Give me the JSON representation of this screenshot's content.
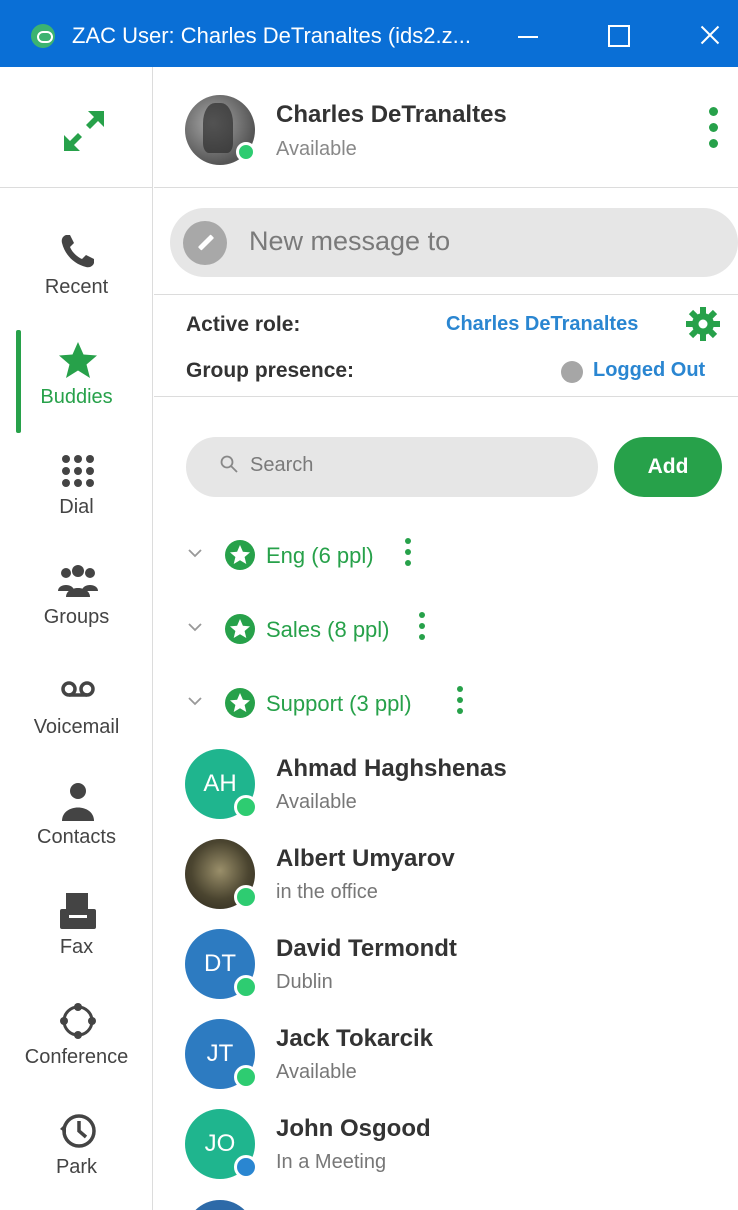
{
  "window": {
    "title": "ZAC User: Charles DeTranaltes (ids2.z..."
  },
  "nav": {
    "items": [
      {
        "label": "Recent",
        "icon": "phone-icon"
      },
      {
        "label": "Buddies",
        "icon": "star-icon",
        "active": true
      },
      {
        "label": "Dial",
        "icon": "dialpad-icon"
      },
      {
        "label": "Groups",
        "icon": "group-icon"
      },
      {
        "label": "Voicemail",
        "icon": "voicemail-icon"
      },
      {
        "label": "Contacts",
        "icon": "person-icon"
      },
      {
        "label": "Fax",
        "icon": "fax-icon"
      },
      {
        "label": "Conference",
        "icon": "conference-icon"
      },
      {
        "label": "Park",
        "icon": "clock-icon"
      }
    ]
  },
  "user": {
    "name": "Charles DeTranaltes",
    "status": "Available"
  },
  "compose": {
    "placeholder": "New message to"
  },
  "role": {
    "active_role_label": "Active role:",
    "active_role_value": "Charles DeTranaltes",
    "group_presence_label": "Group presence:",
    "group_presence_value": "Logged Out"
  },
  "search": {
    "placeholder": "Search"
  },
  "add_button": "Add",
  "groups": [
    {
      "label": "Eng (6 ppl)"
    },
    {
      "label": "Sales (8 ppl)"
    },
    {
      "label": "Support (3 ppl)"
    }
  ],
  "buddies": [
    {
      "initials": "AH",
      "name": "Ahmad Haghshenas",
      "status": "Available",
      "presence": "available"
    },
    {
      "initials": "",
      "name": "Albert Umyarov",
      "status": "in the office",
      "presence": "available"
    },
    {
      "initials": "DT",
      "name": "David Termondt",
      "status": "Dublin",
      "presence": "available"
    },
    {
      "initials": "JT",
      "name": "Jack Tokarcik",
      "status": "Available",
      "presence": "available"
    },
    {
      "initials": "JO",
      "name": "John Osgood",
      "status": "In a Meeting",
      "presence": "in-meeting"
    }
  ],
  "colors": {
    "titlebar": "#0a6fd6",
    "accent_green": "#27a14a",
    "link_blue": "#2a86d1",
    "presence_available": "#2ecc71",
    "presence_meeting": "#2a86d1",
    "presence_logged_out": "#a6a6a6"
  }
}
